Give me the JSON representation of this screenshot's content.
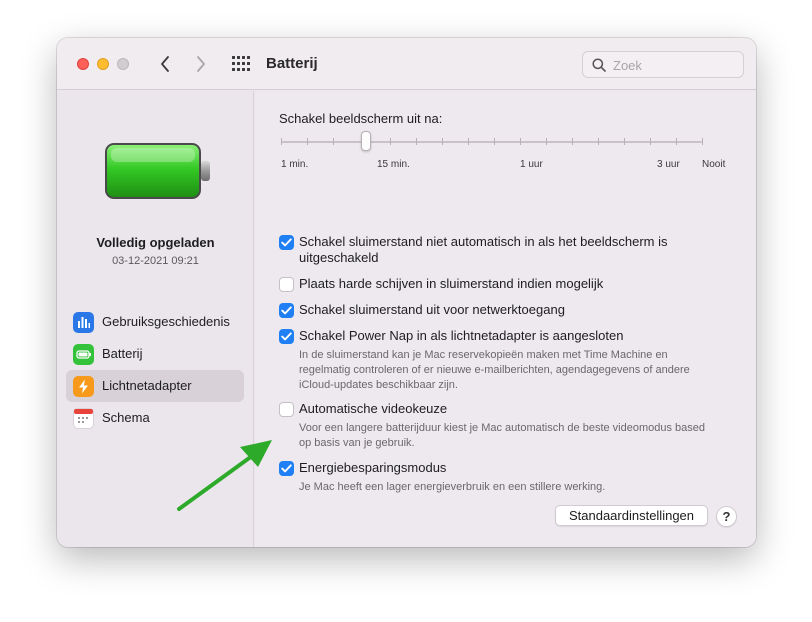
{
  "window": {
    "title": "Batterij",
    "search_placeholder": "Zoek"
  },
  "sidebar": {
    "status_title": "Volledig opgeladen",
    "status_time": "03-12-2021 09:21",
    "items": [
      {
        "label": "Gebruiksgeschiedenis",
        "icon": "bar-chart-icon",
        "selected": false
      },
      {
        "label": "Batterij",
        "icon": "battery-icon",
        "selected": false
      },
      {
        "label": "Lichtnetadapter",
        "icon": "lightning-icon",
        "selected": true
      },
      {
        "label": "Schema",
        "icon": "calendar-icon",
        "selected": false
      }
    ]
  },
  "display_sleep": {
    "label": "Schakel beeldscherm uit na:",
    "tick_labels": [
      "1 min.",
      "15 min.",
      "1 uur",
      "3 uur",
      "Nooit"
    ],
    "selected": "15 min."
  },
  "options": [
    {
      "label": "Schakel sluimerstand niet automatisch in als het beeldscherm is uitgeschakeld",
      "checked": true,
      "description": ""
    },
    {
      "label": "Plaats harde schijven in sluimerstand indien mogelijk",
      "checked": false,
      "description": ""
    },
    {
      "label": "Schakel sluimerstand uit voor netwerktoegang",
      "checked": true,
      "description": ""
    },
    {
      "label": "Schakel Power Nap in als lichtnetadapter is aangesloten",
      "checked": true,
      "description": "In de sluimerstand kan je Mac reservekopieën maken met Time Machine en regelmatig controleren of er nieuwe e-mailberichten, agendagegevens of andere iCloud-updates beschikbaar zijn."
    },
    {
      "label": "Automatische videokeuze",
      "checked": false,
      "description": "Voor een langere batterijduur kiest je Mac automatisch de beste videomodus based op basis van je gebruik."
    },
    {
      "label": "Energiebesparingsmodus",
      "checked": true,
      "description": "Je Mac heeft een lager energieverbruik en een stillere werking."
    }
  ],
  "buttons": {
    "defaults": "Standaardinstellingen",
    "help": "?"
  },
  "colors": {
    "accent": "#1f7ff4",
    "battery_green": "#34c924",
    "annotation_arrow": "#2eaa2a"
  }
}
